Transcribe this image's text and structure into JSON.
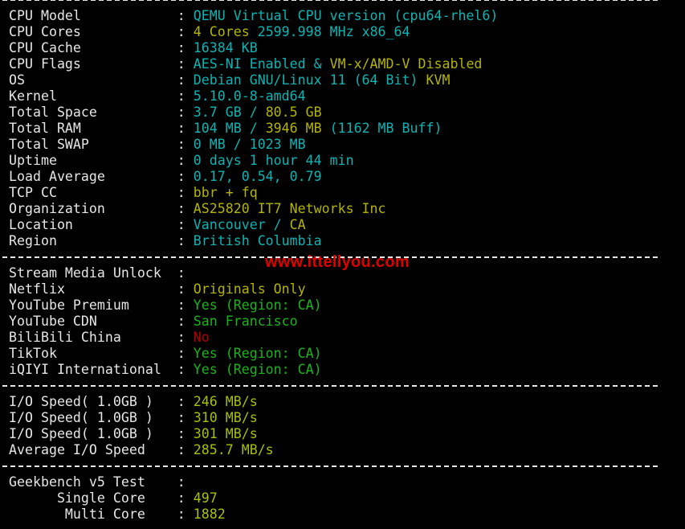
{
  "watermark": "www.ittellyou.com",
  "colors": {
    "cyan": "#0cb4b4",
    "yellow": "#b4b400",
    "green": "#1cb41c",
    "red": "#b40000",
    "lime": "#a8c000",
    "white": "#e6e6e6"
  },
  "lines": [
    {
      "sep": true
    },
    {
      "label": "CPU Model",
      "segs": [
        {
          "t": "QEMU Virtual CPU version (cpu64-rhel6)",
          "c": "cyan"
        }
      ]
    },
    {
      "label": "CPU Cores",
      "segs": [
        {
          "t": "4 Cores ",
          "c": "yellow"
        },
        {
          "t": "2599.998 MHz x86_64",
          "c": "cyan"
        }
      ]
    },
    {
      "label": "CPU Cache",
      "segs": [
        {
          "t": "16384 KB",
          "c": "cyan"
        }
      ]
    },
    {
      "label": "CPU Flags",
      "segs": [
        {
          "t": "AES-NI Enabled & ",
          "c": "cyan"
        },
        {
          "t": "VM-x/AMD-V Disabled",
          "c": "yellow"
        }
      ]
    },
    {
      "label": "OS",
      "segs": [
        {
          "t": "Debian GNU/Linux 11 (64 Bit) ",
          "c": "cyan"
        },
        {
          "t": "KVM",
          "c": "yellow"
        }
      ]
    },
    {
      "label": "Kernel",
      "segs": [
        {
          "t": "5.10.0-8-amd64",
          "c": "cyan"
        }
      ]
    },
    {
      "label": "Total Space",
      "segs": [
        {
          "t": "3.7 GB / ",
          "c": "cyan"
        },
        {
          "t": "80.5 GB",
          "c": "yellow"
        }
      ]
    },
    {
      "label": "Total RAM",
      "segs": [
        {
          "t": "104 MB / ",
          "c": "cyan"
        },
        {
          "t": "3946 MB",
          "c": "yellow"
        },
        {
          "t": " (1162 MB Buff)",
          "c": "cyan"
        }
      ]
    },
    {
      "label": "Total SWAP",
      "segs": [
        {
          "t": "0 MB / 1023 MB",
          "c": "cyan"
        }
      ]
    },
    {
      "label": "Uptime",
      "segs": [
        {
          "t": "0 days 1 hour 44 min",
          "c": "cyan"
        }
      ]
    },
    {
      "label": "Load Average",
      "segs": [
        {
          "t": "0.17, 0.54, 0.79",
          "c": "cyan"
        }
      ]
    },
    {
      "label": "TCP CC",
      "segs": [
        {
          "t": "bbr + fq",
          "c": "yellow"
        }
      ]
    },
    {
      "label": "Organization",
      "segs": [
        {
          "t": "AS25820 IT7 Networks Inc",
          "c": "yellow"
        }
      ]
    },
    {
      "label": "Location",
      "segs": [
        {
          "t": "Vancouver / ",
          "c": "cyan"
        },
        {
          "t": "CA",
          "c": "yellow"
        }
      ]
    },
    {
      "label": "Region",
      "segs": [
        {
          "t": "British Columbia",
          "c": "cyan"
        }
      ]
    },
    {
      "sep": true
    },
    {
      "label": "Stream Media Unlock",
      "segs": []
    },
    {
      "label": "Netflix",
      "segs": [
        {
          "t": "Originals Only",
          "c": "yellow"
        }
      ]
    },
    {
      "label": "YouTube Premium",
      "segs": [
        {
          "t": "Yes (Region: CA)",
          "c": "green"
        }
      ]
    },
    {
      "label": "YouTube CDN",
      "segs": [
        {
          "t": "San Francisco",
          "c": "green"
        }
      ]
    },
    {
      "label": "BiliBili China",
      "segs": [
        {
          "t": "No",
          "c": "red"
        }
      ]
    },
    {
      "label": "TikTok",
      "segs": [
        {
          "t": "Yes (Region: CA)",
          "c": "green"
        }
      ]
    },
    {
      "label": "iQIYI International",
      "segs": [
        {
          "t": "Yes (Region: CA)",
          "c": "green"
        }
      ]
    },
    {
      "sep": true
    },
    {
      "label": "I/O Speed( 1.0GB )",
      "segs": [
        {
          "t": "246 MB/s",
          "c": "lime"
        }
      ]
    },
    {
      "label": "I/O Speed( 1.0GB )",
      "segs": [
        {
          "t": "310 MB/s",
          "c": "lime"
        }
      ]
    },
    {
      "label": "I/O Speed( 1.0GB )",
      "segs": [
        {
          "t": "301 MB/s",
          "c": "lime"
        }
      ]
    },
    {
      "label": "Average I/O Speed",
      "segs": [
        {
          "t": "285.7 MB/s",
          "c": "lime"
        }
      ]
    },
    {
      "sep": true
    },
    {
      "label": "Geekbench v5 Test",
      "segs": []
    },
    {
      "label": "      Single Core",
      "segs": [
        {
          "t": "497",
          "c": "lime"
        }
      ]
    },
    {
      "label": "       Multi Core",
      "segs": [
        {
          "t": "1882",
          "c": "lime"
        }
      ]
    }
  ]
}
